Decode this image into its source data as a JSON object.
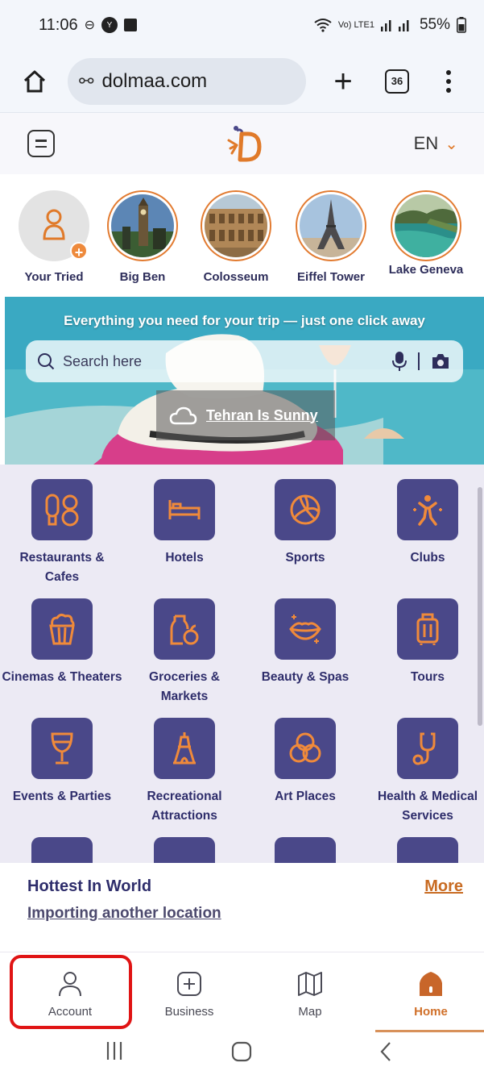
{
  "status_bar": {
    "time": "11:06",
    "battery": "55%",
    "network": "Vo) LTE1"
  },
  "browser": {
    "url": "dolmaa.com",
    "tab_count": "36"
  },
  "site_header": {
    "language": "EN"
  },
  "stories": [
    {
      "label": "Your Tried"
    },
    {
      "label": "Big Ben"
    },
    {
      "label": "Colosseum"
    },
    {
      "label": "Eiffel Tower"
    },
    {
      "label": "Lake Geneva"
    }
  ],
  "hero": {
    "tagline": "Everything you need for your trip — just one click away",
    "search_placeholder": "Search here",
    "weather": "Tehran Is Sunny"
  },
  "categories": [
    {
      "label": "Restaurants & Cafes",
      "icon": "utensils-icon"
    },
    {
      "label": "Hotels",
      "icon": "bed-icon"
    },
    {
      "label": "Sports",
      "icon": "volleyball-icon"
    },
    {
      "label": "Clubs",
      "icon": "dancer-icon"
    },
    {
      "label": "Cinemas & Theaters",
      "icon": "popcorn-icon"
    },
    {
      "label": "Groceries & Markets",
      "icon": "grocery-bottle-icon"
    },
    {
      "label": "Beauty & Spas",
      "icon": "lips-icon"
    },
    {
      "label": "Tours",
      "icon": "luggage-icon"
    },
    {
      "label": "Events & Parties",
      "icon": "glass-icon"
    },
    {
      "label": "Recreational Attractions",
      "icon": "tower-icon"
    },
    {
      "label": "Art Places",
      "icon": "art-circles-icon"
    },
    {
      "label": "Health & Medical Services",
      "icon": "stethoscope-icon"
    }
  ],
  "hottest": {
    "title": "Hottest In World",
    "more": "More",
    "import": "Importing another location"
  },
  "bottom_nav": [
    {
      "label": "Account",
      "icon": "person-icon"
    },
    {
      "label": "Business",
      "icon": "plus-square-icon"
    },
    {
      "label": "Map",
      "icon": "map-icon"
    },
    {
      "label": "Home",
      "icon": "home-icon"
    }
  ],
  "colors": {
    "brand_purple": "#4a4889",
    "accent_orange": "#d0702a",
    "highlight_red": "#e01414"
  }
}
